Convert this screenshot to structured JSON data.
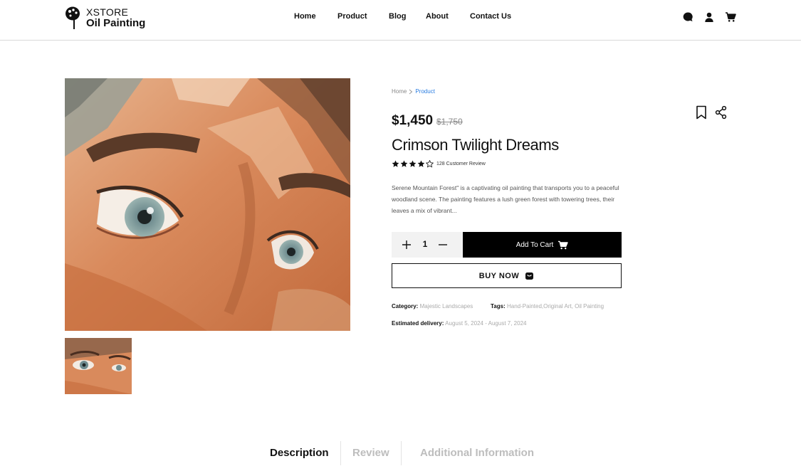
{
  "brand": {
    "line1": "XSTORE",
    "line2": "Oil Painting"
  },
  "nav": [
    "Home",
    "Product",
    "Blog",
    "About",
    "Contact Us"
  ],
  "header_icons": [
    "chat-icon",
    "user-icon",
    "cart-icon"
  ],
  "breadcrumb": {
    "home": "Home",
    "current": "Product"
  },
  "product": {
    "price": "$1,450",
    "old_price": "$1,750",
    "title": "Crimson Twilight Dreams",
    "rating": 4,
    "rating_max": 5,
    "review_text": "128 Customer Review",
    "description": "Serene Mountain Forest\" is a captivating oil painting that transports you to a peaceful woodland scene. The painting features a lush green forest with towering trees, their leaves a mix of vibrant...",
    "quantity": "1",
    "add_to_cart": "Add To Cart",
    "buy_now": "BUY NOW",
    "category_label": "Category:",
    "category": "Majestic Landscapes",
    "tags_label": "Tags:",
    "tags": "Hand-Painted,Original Art, Oil Painting",
    "delivery_label": "Estimated delivery:",
    "delivery": "August 5, 2024 - August 7, 2024"
  },
  "tabs": [
    "Description",
    "Review",
    "Additional Information"
  ],
  "colors": {
    "accent": "#2a7de1",
    "primary": "#000000",
    "muted": "#aaaaaa"
  }
}
